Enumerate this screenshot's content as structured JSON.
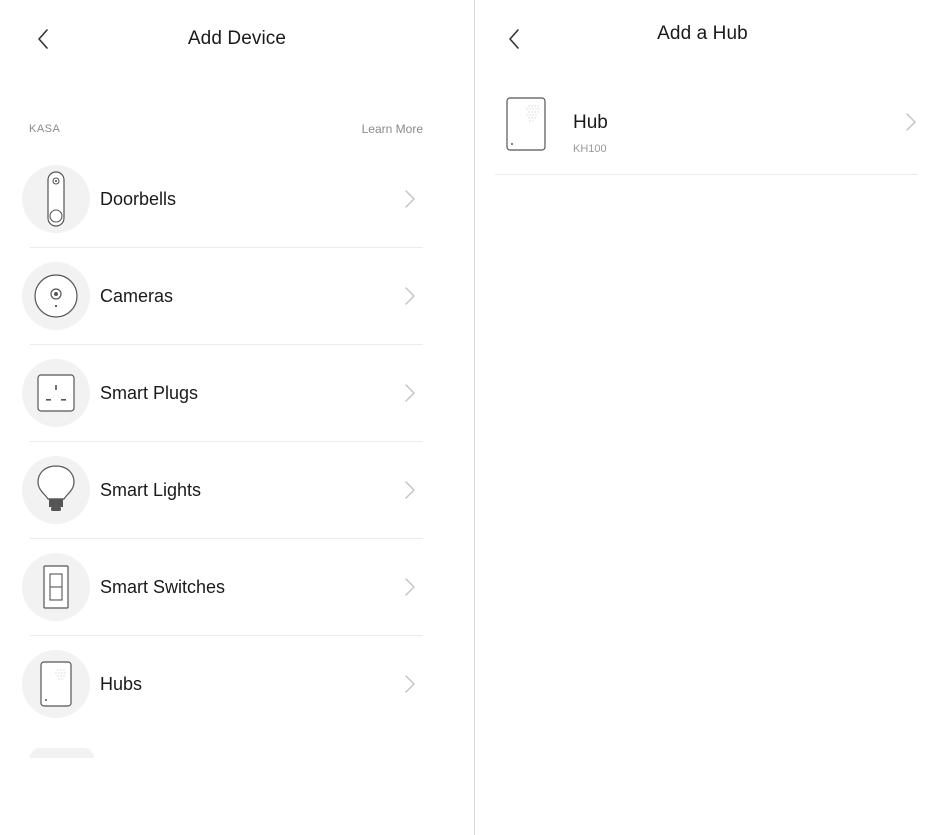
{
  "left_screen": {
    "title": "Add Device",
    "back_icon": "chevron-left-icon",
    "section": {
      "brand": "KASA",
      "learn_more": "Learn More"
    },
    "devices": [
      {
        "label": "Doorbells",
        "icon": "doorbell-icon"
      },
      {
        "label": "Cameras",
        "icon": "camera-icon"
      },
      {
        "label": "Smart Plugs",
        "icon": "smart-plug-icon"
      },
      {
        "label": "Smart Lights",
        "icon": "light-bulb-icon"
      },
      {
        "label": "Smart Switches",
        "icon": "light-switch-icon"
      },
      {
        "label": "Hubs",
        "icon": "hub-icon"
      }
    ]
  },
  "right_screen": {
    "title": "Add a Hub",
    "back_icon": "chevron-left-icon",
    "items": [
      {
        "name": "Hub",
        "model": "KH100",
        "icon": "hub-icon"
      }
    ]
  },
  "colors": {
    "background": "#ffffff",
    "text_primary": "#1a1a1a",
    "text_secondary": "#8a8a8a",
    "icon_circle": "#f2f2f2",
    "divider": "#ebebeb",
    "chevron": "#c4c4c4"
  }
}
